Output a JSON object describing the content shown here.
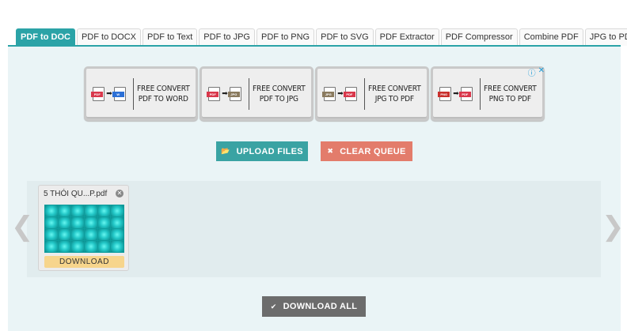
{
  "tabs": [
    {
      "label": "PDF to DOC",
      "active": true
    },
    {
      "label": "PDF to DOCX",
      "active": false
    },
    {
      "label": "PDF to Text",
      "active": false
    },
    {
      "label": "PDF to JPG",
      "active": false
    },
    {
      "label": "PDF to PNG",
      "active": false
    },
    {
      "label": "PDF to SVG",
      "active": false
    },
    {
      "label": "PDF Extractor",
      "active": false
    },
    {
      "label": "PDF Compressor",
      "active": false
    },
    {
      "label": "Combine PDF",
      "active": false
    },
    {
      "label": "JPG to PDF",
      "active": false
    }
  ],
  "ads": [
    {
      "line1": "FREE CONVERT",
      "line2": "PDF TO WORD",
      "from": "PDF",
      "to": "W",
      "from_color": "#d9374b",
      "to_color": "#2b6fd6"
    },
    {
      "line1": "FREE CONVERT",
      "line2": "PDF TO JPG",
      "from": "PDF",
      "to": "JPG",
      "from_color": "#d9374b",
      "to_color": "#8a7a5e"
    },
    {
      "line1": "FREE CONVERT",
      "line2": "JPG TO PDF",
      "from": "JPG",
      "to": "PDF",
      "from_color": "#8a7a5e",
      "to_color": "#d9374b"
    },
    {
      "line1": "FREE CONVERT",
      "line2": "PNG TO PDF",
      "from": "PNG",
      "to": "PDF",
      "from_color": "#c9302c",
      "to_color": "#d9374b"
    }
  ],
  "adchoices": {
    "info_icon": "ⓘ",
    "close_icon": "✕"
  },
  "buttons": {
    "upload": "UPLOAD FILES",
    "clear": "CLEAR QUEUE",
    "download_all": "DOWNLOAD ALL"
  },
  "icons": {
    "upload": "folder-open-icon",
    "clear": "x-icon",
    "download_all": "check-icon"
  },
  "queue": {
    "prev": "❮",
    "next": "❯",
    "files": [
      {
        "name": "5 THÓI QU...P.pdf",
        "download_label": "DOWNLOAD"
      }
    ]
  },
  "colors": {
    "accent": "#2ba3a7",
    "upload": "#3aa3a3",
    "clear": "#e37c6b",
    "download_all": "#6c6c6c",
    "download": "#f7d58c"
  }
}
